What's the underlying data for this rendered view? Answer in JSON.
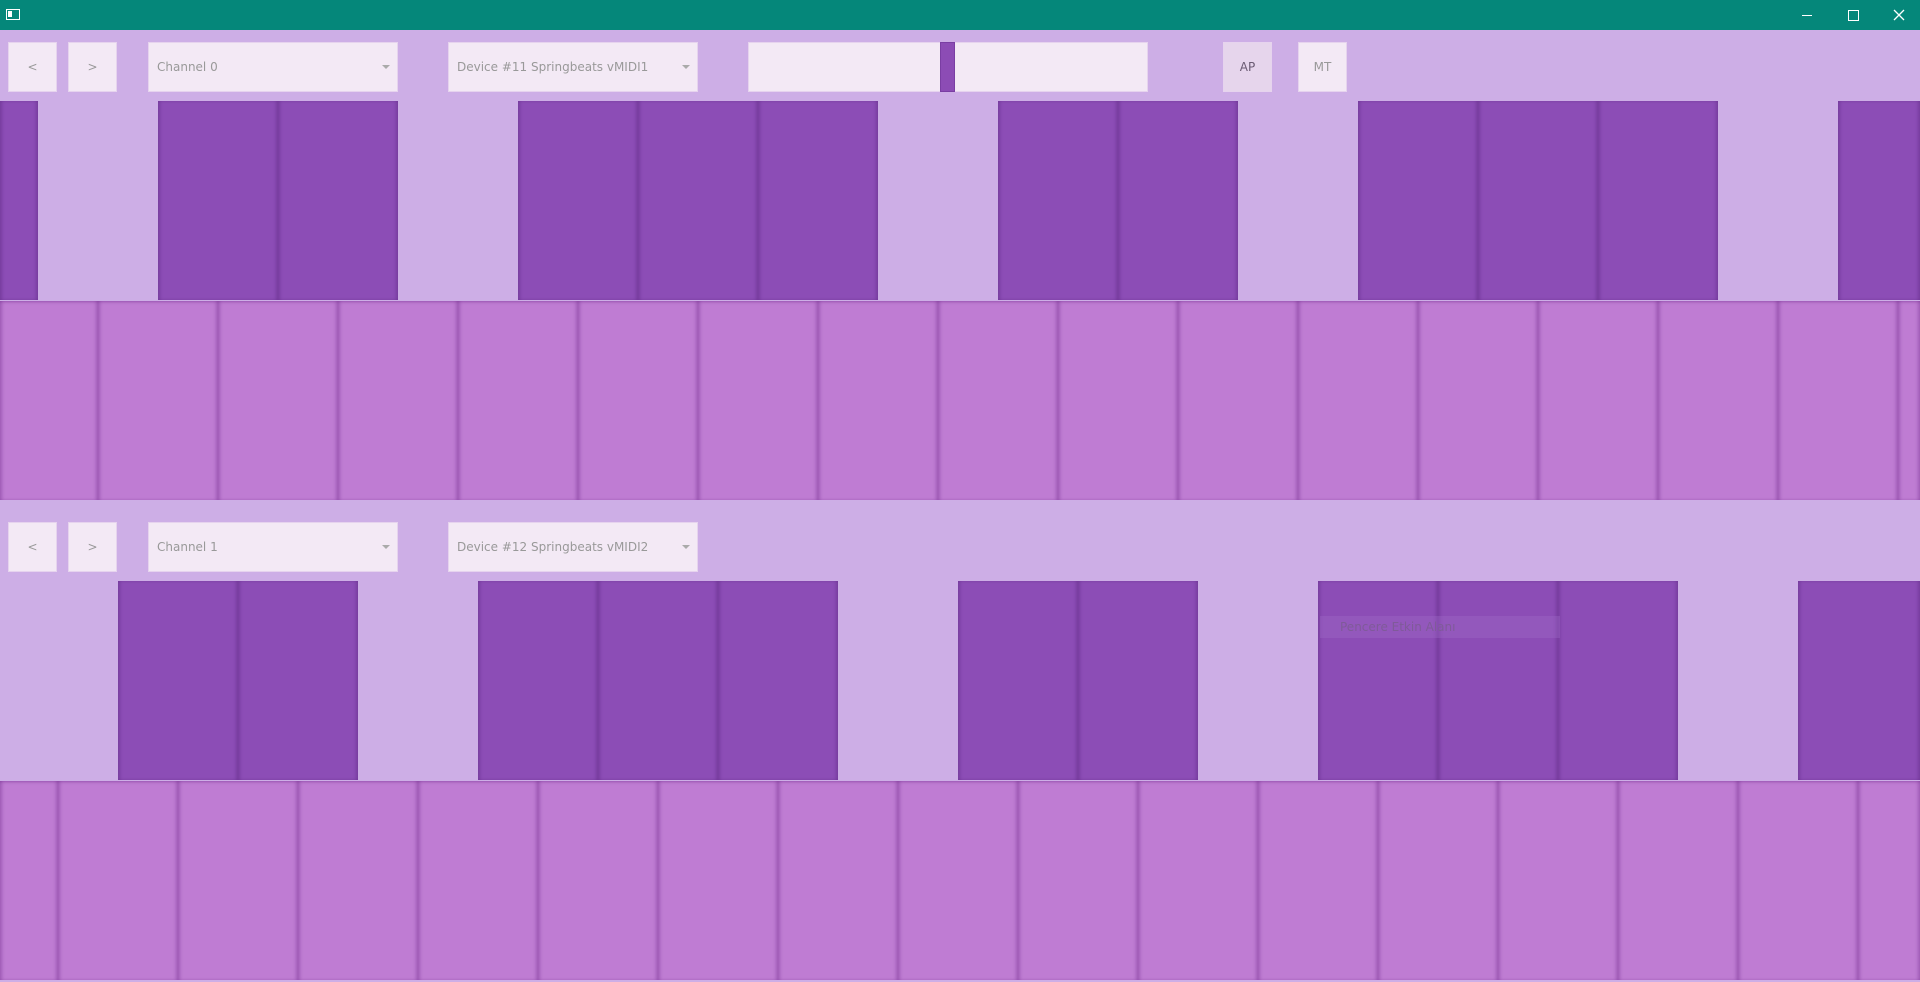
{
  "window": {
    "app_icon": "window-app-icon",
    "controls": [
      "minimize-icon",
      "maximize-icon",
      "close-icon"
    ]
  },
  "tracks": [
    {
      "prev_label": "<",
      "next_label": ">",
      "channel": "Channel 0",
      "device": "Device #11 Springbeats vMIDI1",
      "ap_label": "AP",
      "mt_label": "MT"
    },
    {
      "prev_label": "<",
      "next_label": ">",
      "channel": "Channel 1",
      "device": "Device #12 Springbeats vMIDI2"
    }
  ],
  "tooltip": "Pencere Etkin Alanı",
  "colors": {
    "titlebar": "#05877a",
    "background": "#cdaee6",
    "black_key": "#8c4db6",
    "white_key": "#bf7cd3",
    "control_bg": "#f3e9f5"
  }
}
